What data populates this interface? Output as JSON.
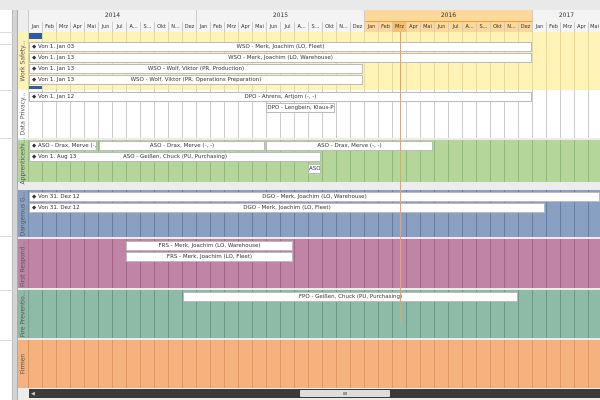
{
  "timeline": {
    "years": [
      "2014",
      "2015",
      "2016",
      "2017"
    ],
    "months": [
      "Jan",
      "Feb",
      "Mrz",
      "Apr",
      "Mai",
      "Jun",
      "Jul",
      "A...",
      "S...",
      "Okt",
      "N...",
      "Dez"
    ],
    "current_year": "2016",
    "current_month": "Mrz"
  },
  "lanes": [
    {
      "label": "Work Safety...",
      "color": "#fff3b8",
      "bars": [
        {
          "prefix": "Von 1. Jan 03",
          "text": "WSO - Merk, Joachim (LO, Fleet)"
        },
        {
          "prefix": "Von 1. Jan 13",
          "text": "WSO - Merk, Joachim (LO, Warehouse)"
        },
        {
          "prefix": "Von 1. Jan 13",
          "text": "WSO - Wolf, Viktor (PR, Production)"
        },
        {
          "prefix": "Von 1. Jan 13",
          "text": "WSO - Wolf, Viktor (PR, Operations Preparation)"
        }
      ]
    },
    {
      "label": "Data Privacy...",
      "color": "#ffffff",
      "bars": [
        {
          "prefix": "Von 1. Jan 12",
          "text": "DPO - Ahrens, Artjom (-, -)"
        },
        {
          "prefix": "",
          "text": "DPO - Lengbein, Klaus-P"
        }
      ]
    },
    {
      "label": "Apprenticeshi...",
      "color": "#b5d69a",
      "bars": [
        {
          "prefix": "ASO - Drax, Merve (-,",
          "text": ""
        },
        {
          "prefix": "",
          "text": "ASO - Drax, Merve (-, -)"
        },
        {
          "prefix": "",
          "text": "ASO - Drax, Merve (-, -)"
        },
        {
          "prefix": "Von 1. Aug 13",
          "text": "ASO - Geißen, Chuck        (PU, Purchasing)"
        },
        {
          "prefix": "",
          "text": "ASO"
        }
      ]
    },
    {
      "label": "Dangerous G...",
      "color": "#8aa0c2",
      "bars": [
        {
          "prefix": "Von 31. Dez 12",
          "text": "DGO - Merk, Joachim (LO, Warehouse)"
        },
        {
          "prefix": "Von 31. Dez 12",
          "text": "DGO - Merk, Joachim (LO, Fleet)"
        }
      ]
    },
    {
      "label": "First Respond...",
      "color": "#c085a6",
      "bars": [
        {
          "prefix": "",
          "text": "FRS - Merk, Joachim (LO, Warehouse)"
        },
        {
          "prefix": "",
          "text": "FRS - Merk, Joachim (LO, Fleet)"
        }
      ]
    },
    {
      "label": "Fire Preventio...",
      "color": "#8ebba8",
      "bars": [
        {
          "prefix": "",
          "text": "FPO - Geißen, Chuck        (PU, Purchasing)"
        }
      ]
    },
    {
      "label": "Firmen",
      "color": "#f5b27f",
      "bars": []
    }
  ]
}
